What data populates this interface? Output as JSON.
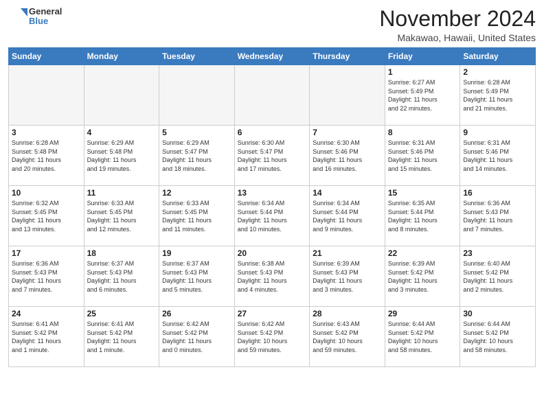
{
  "logo": {
    "general": "General",
    "blue": "Blue"
  },
  "header": {
    "month": "November 2024",
    "location": "Makawao, Hawaii, United States"
  },
  "weekdays": [
    "Sunday",
    "Monday",
    "Tuesday",
    "Wednesday",
    "Thursday",
    "Friday",
    "Saturday"
  ],
  "weeks": [
    [
      {
        "day": "",
        "info": ""
      },
      {
        "day": "",
        "info": ""
      },
      {
        "day": "",
        "info": ""
      },
      {
        "day": "",
        "info": ""
      },
      {
        "day": "",
        "info": ""
      },
      {
        "day": "1",
        "info": "Sunrise: 6:27 AM\nSunset: 5:49 PM\nDaylight: 11 hours\nand 22 minutes."
      },
      {
        "day": "2",
        "info": "Sunrise: 6:28 AM\nSunset: 5:49 PM\nDaylight: 11 hours\nand 21 minutes."
      }
    ],
    [
      {
        "day": "3",
        "info": "Sunrise: 6:28 AM\nSunset: 5:48 PM\nDaylight: 11 hours\nand 20 minutes."
      },
      {
        "day": "4",
        "info": "Sunrise: 6:29 AM\nSunset: 5:48 PM\nDaylight: 11 hours\nand 19 minutes."
      },
      {
        "day": "5",
        "info": "Sunrise: 6:29 AM\nSunset: 5:47 PM\nDaylight: 11 hours\nand 18 minutes."
      },
      {
        "day": "6",
        "info": "Sunrise: 6:30 AM\nSunset: 5:47 PM\nDaylight: 11 hours\nand 17 minutes."
      },
      {
        "day": "7",
        "info": "Sunrise: 6:30 AM\nSunset: 5:46 PM\nDaylight: 11 hours\nand 16 minutes."
      },
      {
        "day": "8",
        "info": "Sunrise: 6:31 AM\nSunset: 5:46 PM\nDaylight: 11 hours\nand 15 minutes."
      },
      {
        "day": "9",
        "info": "Sunrise: 6:31 AM\nSunset: 5:46 PM\nDaylight: 11 hours\nand 14 minutes."
      }
    ],
    [
      {
        "day": "10",
        "info": "Sunrise: 6:32 AM\nSunset: 5:45 PM\nDaylight: 11 hours\nand 13 minutes."
      },
      {
        "day": "11",
        "info": "Sunrise: 6:33 AM\nSunset: 5:45 PM\nDaylight: 11 hours\nand 12 minutes."
      },
      {
        "day": "12",
        "info": "Sunrise: 6:33 AM\nSunset: 5:45 PM\nDaylight: 11 hours\nand 11 minutes."
      },
      {
        "day": "13",
        "info": "Sunrise: 6:34 AM\nSunset: 5:44 PM\nDaylight: 11 hours\nand 10 minutes."
      },
      {
        "day": "14",
        "info": "Sunrise: 6:34 AM\nSunset: 5:44 PM\nDaylight: 11 hours\nand 9 minutes."
      },
      {
        "day": "15",
        "info": "Sunrise: 6:35 AM\nSunset: 5:44 PM\nDaylight: 11 hours\nand 8 minutes."
      },
      {
        "day": "16",
        "info": "Sunrise: 6:36 AM\nSunset: 5:43 PM\nDaylight: 11 hours\nand 7 minutes."
      }
    ],
    [
      {
        "day": "17",
        "info": "Sunrise: 6:36 AM\nSunset: 5:43 PM\nDaylight: 11 hours\nand 7 minutes."
      },
      {
        "day": "18",
        "info": "Sunrise: 6:37 AM\nSunset: 5:43 PM\nDaylight: 11 hours\nand 6 minutes."
      },
      {
        "day": "19",
        "info": "Sunrise: 6:37 AM\nSunset: 5:43 PM\nDaylight: 11 hours\nand 5 minutes."
      },
      {
        "day": "20",
        "info": "Sunrise: 6:38 AM\nSunset: 5:43 PM\nDaylight: 11 hours\nand 4 minutes."
      },
      {
        "day": "21",
        "info": "Sunrise: 6:39 AM\nSunset: 5:43 PM\nDaylight: 11 hours\nand 3 minutes."
      },
      {
        "day": "22",
        "info": "Sunrise: 6:39 AM\nSunset: 5:42 PM\nDaylight: 11 hours\nand 3 minutes."
      },
      {
        "day": "23",
        "info": "Sunrise: 6:40 AM\nSunset: 5:42 PM\nDaylight: 11 hours\nand 2 minutes."
      }
    ],
    [
      {
        "day": "24",
        "info": "Sunrise: 6:41 AM\nSunset: 5:42 PM\nDaylight: 11 hours\nand 1 minute."
      },
      {
        "day": "25",
        "info": "Sunrise: 6:41 AM\nSunset: 5:42 PM\nDaylight: 11 hours\nand 1 minute."
      },
      {
        "day": "26",
        "info": "Sunrise: 6:42 AM\nSunset: 5:42 PM\nDaylight: 11 hours\nand 0 minutes."
      },
      {
        "day": "27",
        "info": "Sunrise: 6:42 AM\nSunset: 5:42 PM\nDaylight: 10 hours\nand 59 minutes."
      },
      {
        "day": "28",
        "info": "Sunrise: 6:43 AM\nSunset: 5:42 PM\nDaylight: 10 hours\nand 59 minutes."
      },
      {
        "day": "29",
        "info": "Sunrise: 6:44 AM\nSunset: 5:42 PM\nDaylight: 10 hours\nand 58 minutes."
      },
      {
        "day": "30",
        "info": "Sunrise: 6:44 AM\nSunset: 5:42 PM\nDaylight: 10 hours\nand 58 minutes."
      }
    ]
  ]
}
